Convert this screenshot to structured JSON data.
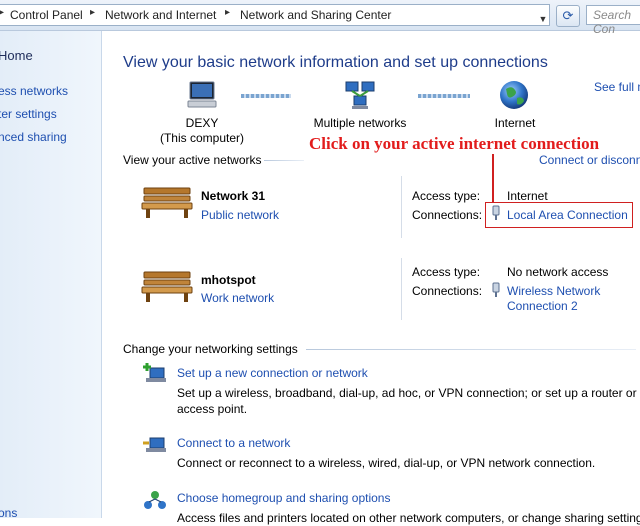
{
  "address_bar": {
    "crumbs": [
      "Control Panel",
      "Network and Internet",
      "Network and Sharing Center"
    ],
    "search_placeholder": "Search Con"
  },
  "left_pane": {
    "items": [
      "Home",
      "ess networks",
      "ter settings",
      "nced sharing",
      "ons"
    ]
  },
  "main": {
    "title": "View your basic network information and set up connections",
    "see_full_map": "See full m",
    "map": {
      "computer_name": "DEXY",
      "computer_sub": "(This computer)",
      "middle": "Multiple networks",
      "internet": "Internet"
    },
    "active_networks_label": "View your active networks",
    "connect_disconnect": "Connect or disconn",
    "annotation": "Click on your active internet connection",
    "networks": [
      {
        "name": "Network  31",
        "category": "Public network",
        "access_label": "Access type:",
        "access_value": "Internet",
        "connections_label": "Connections:",
        "connection_line1": "Local Area Connection",
        "connection_line2": ""
      },
      {
        "name": "mhotspot",
        "category": "Work network",
        "access_label": "Access type:",
        "access_value": "No network access",
        "connections_label": "Connections:",
        "connection_line1": "Wireless Network",
        "connection_line2": "Connection 2"
      }
    ],
    "change_settings_label": "Change your networking settings",
    "tasks": [
      {
        "title": "Set up a new connection or network",
        "description": "Set up a wireless, broadband, dial-up, ad hoc, or VPN connection; or set up a router or access point."
      },
      {
        "title": "Connect to a network",
        "description": "Connect or reconnect to a wireless, wired, dial-up, or VPN network connection."
      },
      {
        "title": "Choose homegroup and sharing options",
        "description": "Access files and printers located on other network computers, or change sharing settings."
      }
    ]
  },
  "colors": {
    "link": "#1e4fb0",
    "title": "#1e3c8a",
    "annotation": "#e21c1c"
  }
}
